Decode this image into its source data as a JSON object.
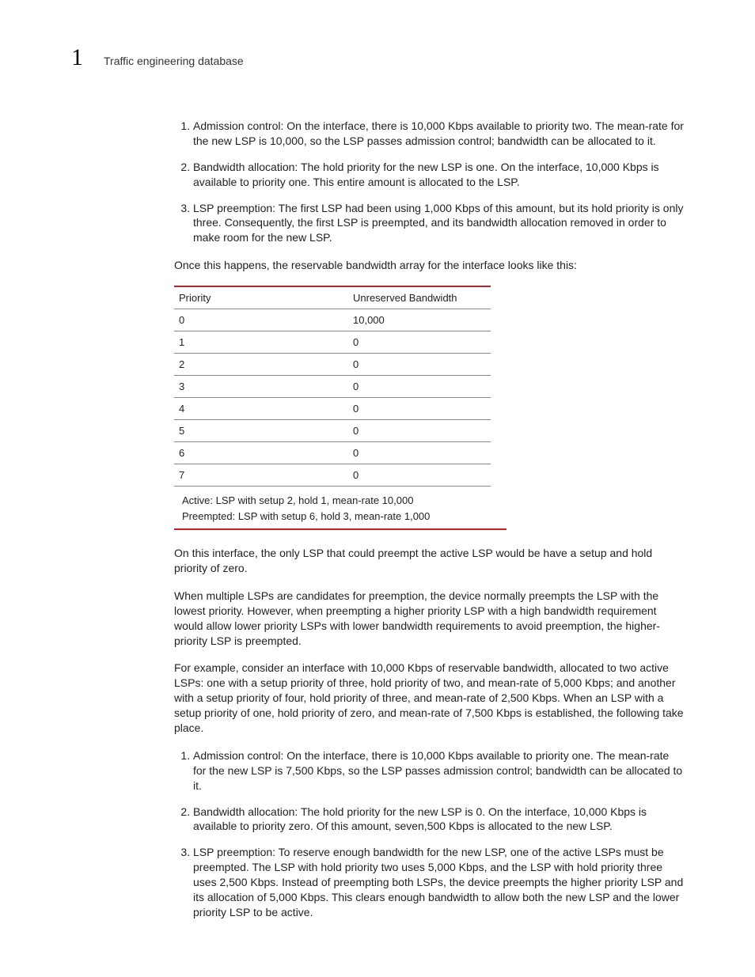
{
  "header": {
    "chapterNumber": "1",
    "title": "Traffic engineering database"
  },
  "list1": [
    "Admission control: On the interface, there is 10,000 Kbps available to priority two. The mean-rate for the new LSP is 10,000, so the LSP passes admission control; bandwidth can be allocated to it.",
    "Bandwidth allocation: The hold priority for the new LSP is one. On the interface, 10,000 Kbps is available to priority one. This entire amount is allocated to the LSP.",
    "LSP preemption: The first LSP had been using 1,000 Kbps of this amount, but its hold priority is only three. Consequently, the first LSP is preempted, and its bandwidth allocation removed in order to make room for the new LSP."
  ],
  "para1": "Once this happens, the reservable bandwidth array for the interface looks like this:",
  "table": {
    "headers": [
      "Priority",
      "Unreserved Bandwidth"
    ],
    "rows": [
      [
        "0",
        "10,000"
      ],
      [
        "1",
        "0"
      ],
      [
        "2",
        "0"
      ],
      [
        "3",
        "0"
      ],
      [
        "4",
        "0"
      ],
      [
        "5",
        "0"
      ],
      [
        "6",
        "0"
      ],
      [
        "7",
        "0"
      ]
    ],
    "notes": [
      "Active: LSP with setup 2, hold 1, mean-rate 10,000",
      "Preempted: LSP with setup 6, hold 3, mean-rate 1,000"
    ]
  },
  "para2": "On this interface, the only LSP that could preempt the active LSP would be have a setup and hold priority of zero.",
  "para3": "When multiple LSPs are candidates for preemption, the device normally preempts the LSP with the lowest priority. However, when preempting a higher priority LSP with a high bandwidth requirement would allow lower priority LSPs with lower bandwidth requirements to avoid preemption, the higher-priority LSP is preempted.",
  "para4": "For example, consider an interface with 10,000 Kbps of reservable bandwidth, allocated to two active LSPs: one with a setup priority of three, hold priority of two, and mean-rate of 5,000 Kbps; and another with a setup priority of four, hold priority of three, and mean-rate of 2,500 Kbps. When an LSP with a setup priority of one, hold priority of zero, and mean-rate of 7,500 Kbps is established, the following take place.",
  "list2": [
    "Admission control: On the interface, there is 10,000 Kbps available to priority one. The mean-rate for the new LSP is 7,500 Kbps, so the LSP passes admission control; bandwidth can be allocated to it.",
    "Bandwidth allocation: The hold priority for the new LSP is 0. On the interface, 10,000 Kbps is available to priority zero. Of this amount, seven,500 Kbps is allocated to the new LSP.",
    "LSP preemption: To reserve enough bandwidth for the new LSP, one of the active LSPs must be preempted. The LSP with hold priority two uses 5,000 Kbps, and the LSP with hold priority three uses 2,500 Kbps. Instead of preempting both LSPs, the device preempts the higher priority LSP and its allocation of 5,000 Kbps. This clears enough bandwidth to allow both the new LSP and the lower priority LSP to be active."
  ]
}
